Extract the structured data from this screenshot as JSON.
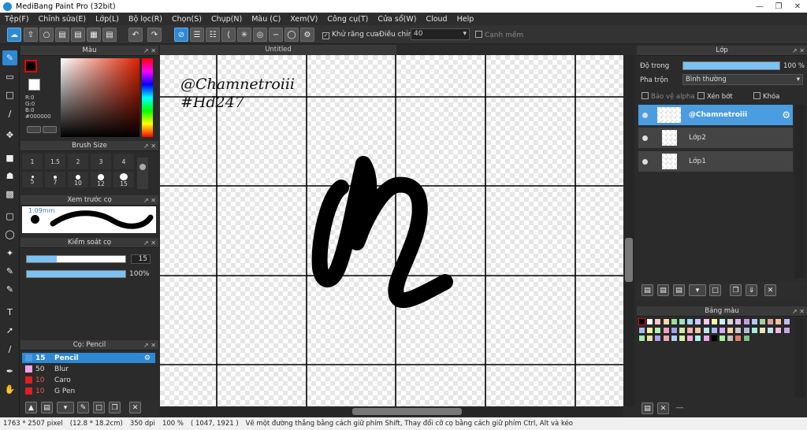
{
  "window": {
    "title": "MediBang Paint Pro (32bit)"
  },
  "menu": [
    "Tệp(F)",
    "Chỉnh sửa(E)",
    "Lớp(L)",
    "Bộ lọc(R)",
    "Chọn(S)",
    "Chụp(N)",
    "Màu (C)",
    "Xem(V)",
    "Công cụ(T)",
    "Cửa sổ(W)",
    "Cloud",
    "Help"
  ],
  "toolbar": {
    "antialias_label": "Khử răng cưa",
    "adjust_label": "Điều chỉnh",
    "adjust_value": "40",
    "edge_label": "Cạnh mềm"
  },
  "color_panel": {
    "title": "Màu",
    "r": "R:0",
    "g": "G:0",
    "b": "B:0",
    "hex": "#000000"
  },
  "brush_size": {
    "title": "Brush Size",
    "sizes": [
      "1",
      "1.5",
      "2",
      "3",
      "4",
      "5",
      "7",
      "10",
      "12",
      "15"
    ]
  },
  "preview": {
    "title": "Xem trước cọ",
    "size": "1.09mm"
  },
  "control": {
    "title": "Kiểm soát cọ",
    "size_value": "15",
    "opacity_value": "100",
    "opacity_unit": "%",
    "size_fraction": 0.3,
    "opacity_fraction": 1.0
  },
  "brush_panel": {
    "title": "Cọ: Pencil",
    "items": [
      {
        "size": "15",
        "name": "Pencil",
        "color": "#4a9de0"
      },
      {
        "size": "50",
        "name": "Blur",
        "color": "#f4a0e8"
      },
      {
        "size": "10",
        "name": "Caro",
        "color": "#e02020"
      },
      {
        "size": "10",
        "name": "G Pen",
        "color": "#e02020"
      }
    ]
  },
  "canvas": {
    "tab": "Untitled",
    "text_line1": "@Chamnetroiii",
    "text_line2": "#Hd247"
  },
  "layer_panel": {
    "title": "Lớp",
    "opacity_label": "Độ trong",
    "opacity_value": "100 %",
    "opacity_fraction": 1.0,
    "blend_label": "Pha trộn",
    "blend_value": "Bình thường",
    "protect_alpha": "Bảo vệ alpha",
    "clipping": "Xén bớt",
    "lock": "Khóa",
    "layers": [
      {
        "name": "@Chamnetroiii",
        "selected": true
      },
      {
        "name": "Lớp2",
        "selected": false
      },
      {
        "name": "Lớp1",
        "selected": false
      }
    ]
  },
  "palette_panel": {
    "title": "Bảng màu",
    "footer": "---",
    "colors": [
      "#000000",
      "#ffffff",
      "#f9c8c8",
      "#f8d8a8",
      "#98e0a0",
      "#a0e0c0",
      "#a8d8f0",
      "#c8c8f8",
      "#f8c8f0",
      "#f8f8b0",
      "#c8f0f8",
      "#d8d8d8",
      "#e0b8e8",
      "#c0a0e0",
      "#b0c8f8",
      "#a0d0a0",
      "#e0a0a0",
      "#f0c0a0",
      "#c0c0f0",
      "#a0c0f0",
      "#f8f0a0",
      "#b0f0b0",
      "#f0a0c0",
      "#a0a0f0",
      "#d0e8a0",
      "#f8b0b0",
      "#e8c8a0",
      "#b8e8e8",
      "#a8b8f8",
      "#d8a8f8",
      "#f8d0a0",
      "#c8c8c8",
      "#b8b8e0",
      "#a0f0d0",
      "#f0e0c0",
      "#c0e0f0",
      "#f0b8d8",
      "#c8a8e0",
      "#a8e8a8",
      "#e0e0a0",
      "#b0a0f0",
      "#f0a8a8",
      "#a8d0f8",
      "#d0f0a8",
      "#f8a8d8",
      "#a8f0f0",
      "#e8a8e8",
      "#000000",
      "#a0f0a0",
      "#c0c0c0",
      "#e08060",
      "#80c080"
    ]
  },
  "status": {
    "size_px": "1763 * 2507 pixel",
    "size_cm": "(12.8 * 18.2cm)",
    "dpi": "350 dpi",
    "zoom": "100 %",
    "coords": "( 1047, 1921 )",
    "hint": "Vẽ một đường thẳng bằng cách giữ phím Shift, Thay đổi cỡ cọ bằng cách giữ phím Ctrl, Alt và kéo"
  }
}
